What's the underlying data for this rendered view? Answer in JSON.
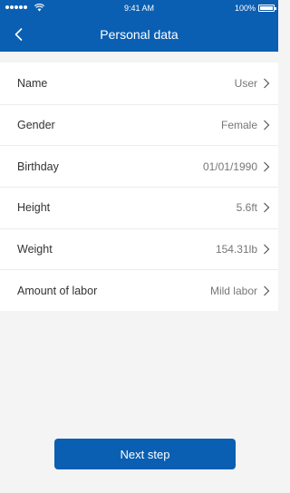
{
  "status_bar": {
    "time": "9:41 AM",
    "battery": "100%"
  },
  "header": {
    "title": "Personal data",
    "back_icon": "chevron-left-icon"
  },
  "fields": [
    {
      "label": "Name",
      "value": "User"
    },
    {
      "label": "Gender",
      "value": "Female"
    },
    {
      "label": "Birthday",
      "value": "01/01/1990"
    },
    {
      "label": "Height",
      "value": "5.6ft"
    },
    {
      "label": "Weight",
      "value": "154.31lb"
    },
    {
      "label": "Amount of labor",
      "value": "Mild labor"
    }
  ],
  "actions": {
    "next_label": "Next step"
  },
  "colors": {
    "accent": "#0b5fb3"
  }
}
